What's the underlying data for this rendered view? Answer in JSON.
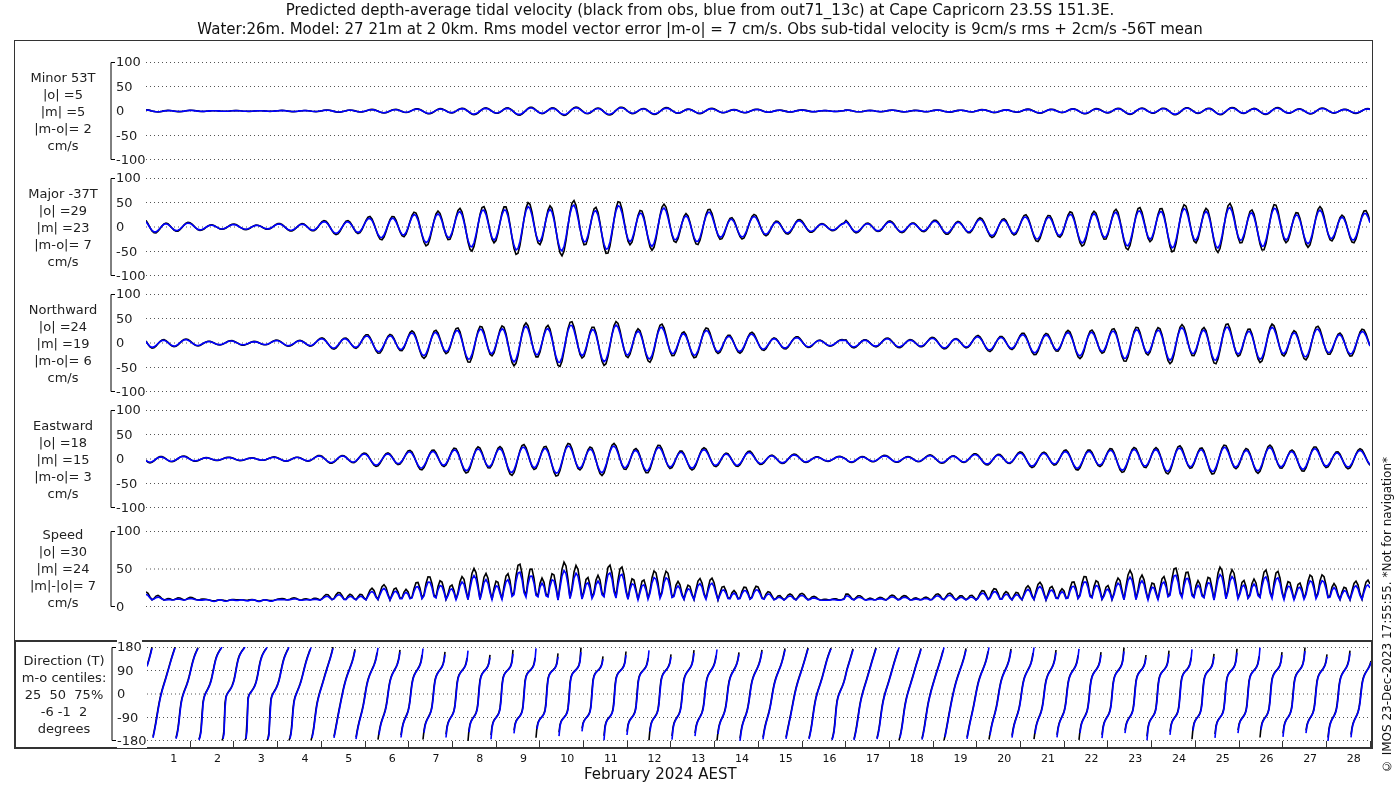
{
  "title_lines": [
    "Predicted depth-average tidal velocity (black from obs, blue from out71_13c) at Cape Capricorn 23.5S 151.3E.",
    "Water:26m. Model: 27 21m at 2 0km. Rms model vector error |m-o| = 7 cm/s. Obs sub-tidal velocity is 9cm/s rms + 2cm/s -56T mean"
  ],
  "panels": [
    {
      "kind": "velocity",
      "label_lines": [
        "Minor 53T",
        "|o| =5",
        "|m| =5",
        "|m-o|= 2",
        "cm/s"
      ],
      "yticks": [
        "100",
        "50",
        "0",
        "-50",
        "-100"
      ]
    },
    {
      "kind": "velocity",
      "label_lines": [
        "Major -37T",
        "|o| =29",
        "|m| =23",
        "|m-o|= 7",
        "cm/s"
      ],
      "yticks": [
        "100",
        "50",
        "0",
        "-50",
        "-100"
      ]
    },
    {
      "kind": "velocity",
      "label_lines": [
        "Northward",
        "|o| =24",
        "|m| =19",
        "|m-o|= 6",
        "cm/s"
      ],
      "yticks": [
        "100",
        "50",
        "0",
        "-50",
        "-100"
      ]
    },
    {
      "kind": "velocity",
      "label_lines": [
        "Eastward",
        "|o| =18",
        "|m| =15",
        "|m-o|= 3",
        "cm/s"
      ],
      "yticks": [
        "100",
        "50",
        "0",
        "-50",
        "-100"
      ]
    },
    {
      "kind": "speed",
      "label_lines": [
        "Speed",
        "|o| =30",
        "|m| =24",
        "|m|-|o|= 7",
        "cm/s"
      ],
      "yticks": [
        "100",
        "50",
        "0"
      ]
    },
    {
      "kind": "direction",
      "label_lines": [
        "Direction (T)",
        "m-o centiles:",
        "25  50  75%",
        "-6 -1  2",
        "degrees"
      ],
      "yticks": [
        "180",
        "90",
        "0",
        "-90",
        "-180"
      ]
    }
  ],
  "x_ticks": [
    "1",
    "2",
    "3",
    "4",
    "5",
    "6",
    "7",
    "8",
    "9",
    "10",
    "11",
    "12",
    "13",
    "14",
    "15",
    "16",
    "17",
    "18",
    "19",
    "20",
    "21",
    "22",
    "23",
    "24",
    "25",
    "26",
    "27",
    "28"
  ],
  "xlabel": "February 2024 AEST",
  "side_note": "© IMOS 23-Dec-2023 17:55:55. *Not for navigation*"
}
